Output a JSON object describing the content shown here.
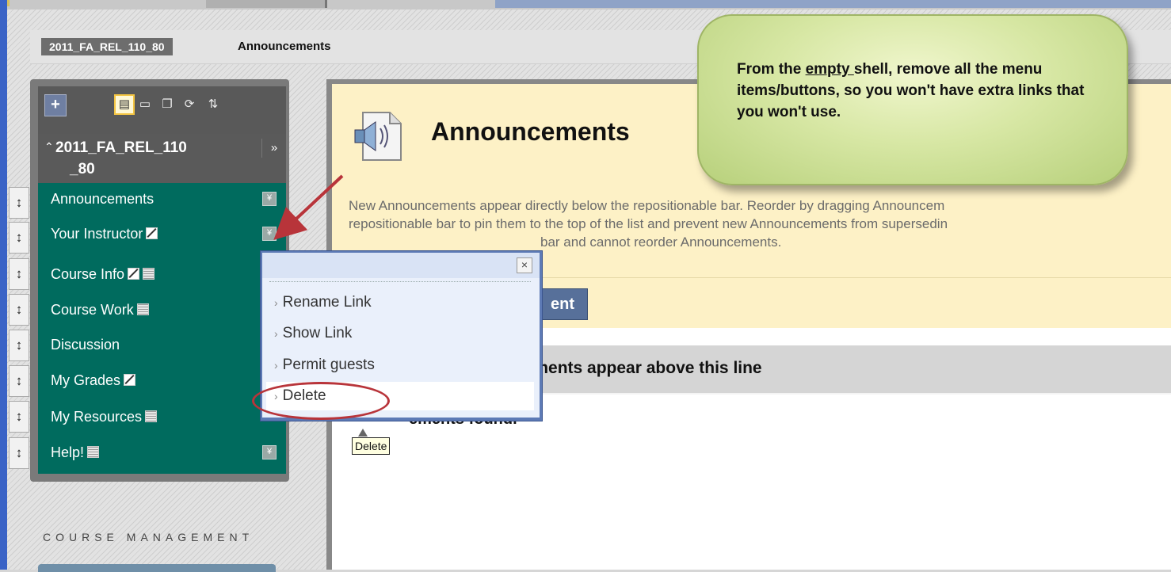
{
  "breadcrumb": {
    "course": "2011_FA_REL_110_80",
    "page": "Announcements"
  },
  "course_menu": {
    "title_line1": "2011_FA_REL_110",
    "title_line2": "_80",
    "toolbar_icons": [
      "add-icon",
      "folder-view-icon",
      "folder-icon",
      "window-icon",
      "refresh-icon",
      "sort-icon"
    ],
    "items": [
      {
        "label": "Announcements",
        "hidden": false,
        "guest": false
      },
      {
        "label": "Your Instructor",
        "hidden": true,
        "guest": false
      },
      {
        "label": "Course Info",
        "hidden": true,
        "guest": true
      },
      {
        "label": "Course Work",
        "hidden": false,
        "guest": true
      },
      {
        "label": "Discussion",
        "hidden": false,
        "guest": false
      },
      {
        "label": "My Grades",
        "hidden": true,
        "guest": false
      },
      {
        "label": "My Resources",
        "hidden": false,
        "guest": true
      },
      {
        "label": "Help!",
        "hidden": false,
        "guest": true
      }
    ]
  },
  "course_management": {
    "label": "COURSE MANAGEMENT"
  },
  "main": {
    "title": "Announcements",
    "description_line1": "New Announcements appear directly below the repositionable bar. Reorder by dragging Announcem",
    "description_line2": "repositionable bar to pin them to the top of the list and prevent new Announcements from supersedin",
    "description_line3": "bar and cannot reorder Announcements.",
    "create_button_visible": "ent",
    "repositionable_bar_visible": "cements appear above this line",
    "no_found_visible": "ements found."
  },
  "context_menu": {
    "items": [
      "Rename Link",
      "Show Link",
      "Permit guests",
      "Delete"
    ],
    "close": "×"
  },
  "tooltip": "Delete",
  "callout": {
    "part1": "From the ",
    "part2_underline": "empty ",
    "part3": "shell, remove all the ",
    "part4_bold": "menu items/buttons",
    "part5": ", so you won't have extra links that you won't use."
  },
  "colors": {
    "menu_bg": "#006b5e",
    "callout_bg": "#d7e7a4",
    "annotation_red": "#b8343a",
    "button_blue": "#57709a"
  }
}
